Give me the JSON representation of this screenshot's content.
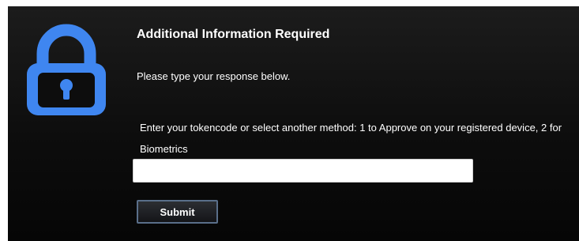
{
  "dialog": {
    "title": "Additional Information Required",
    "subtitle": "Please type your response below.",
    "prompt": "Enter your tokencode or select another method: 1 to Approve on your registered device, 2 for Biometrics",
    "response": {
      "value": "",
      "placeholder": ""
    },
    "submit_label": "Submit",
    "icon": "lock-icon"
  },
  "colors": {
    "panel_background": "#0d0d0d",
    "lock_icon": "#3f86f0",
    "text": "#ffffff"
  }
}
